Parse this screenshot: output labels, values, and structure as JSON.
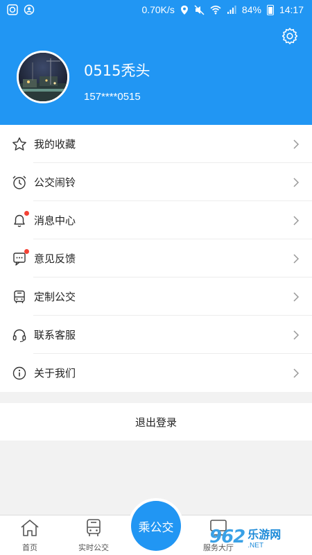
{
  "status_bar": {
    "speed": "0.70K/s",
    "battery": "84%",
    "time": "14:17"
  },
  "profile": {
    "username": "0515秃头",
    "phone": "157****0515"
  },
  "menu": {
    "items": [
      {
        "label": "我的收藏",
        "icon": "star-icon",
        "badge": false
      },
      {
        "label": "公交闹铃",
        "icon": "alarm-clock-icon",
        "badge": false
      },
      {
        "label": "消息中心",
        "icon": "bell-icon",
        "badge": true
      },
      {
        "label": "意见反馈",
        "icon": "feedback-icon",
        "badge": true
      },
      {
        "label": "定制公交",
        "icon": "bus-icon",
        "badge": false
      },
      {
        "label": "联系客服",
        "icon": "headset-icon",
        "badge": false
      },
      {
        "label": "关于我们",
        "icon": "info-icon",
        "badge": false
      }
    ]
  },
  "logout_label": "退出登录",
  "tabs": {
    "home": "首页",
    "realtime": "实时公交",
    "center": "乘公交",
    "service": "服务大厅"
  },
  "watermark": {
    "number": "962",
    "cn": "乐游网",
    "en": ".NET"
  },
  "colors": {
    "primary": "#2196f3",
    "badge": "#f44336",
    "background": "#f2f2f2"
  }
}
